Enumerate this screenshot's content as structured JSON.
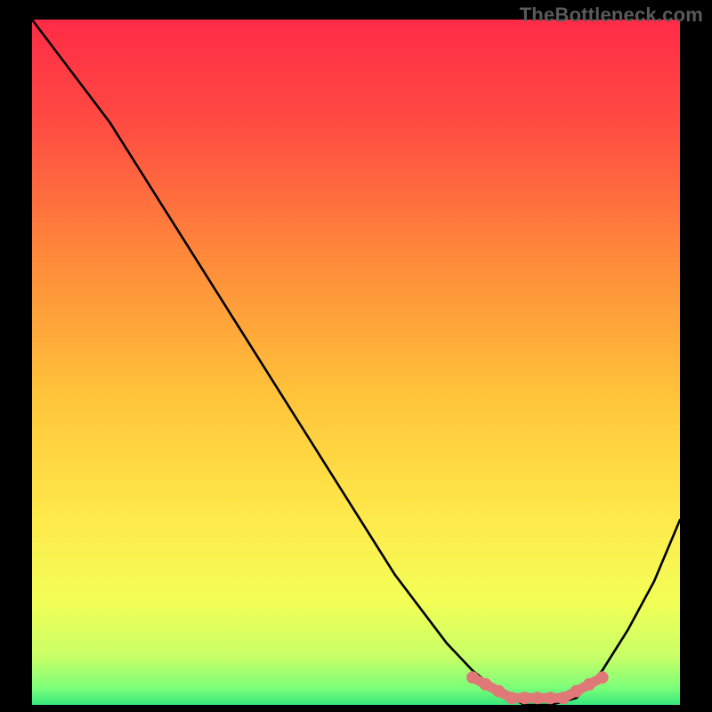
{
  "watermark": "TheBottleneck.com",
  "chart_data": {
    "type": "line",
    "title": "",
    "xlabel": "",
    "ylabel": "",
    "xlim": [
      0,
      100
    ],
    "ylim": [
      0,
      100
    ],
    "grid": false,
    "legend": false,
    "series": [
      {
        "name": "curve",
        "color": "#000000",
        "x": [
          0,
          4,
          8,
          12,
          16,
          20,
          24,
          28,
          32,
          36,
          40,
          44,
          48,
          52,
          56,
          60,
          64,
          68,
          72,
          76,
          80,
          84,
          88,
          92,
          96,
          100
        ],
        "y": [
          100,
          95,
          90,
          85,
          79,
          73,
          67,
          61,
          55,
          49,
          43,
          37,
          31,
          25,
          19,
          14,
          9,
          5,
          2,
          0,
          0,
          1,
          5,
          11,
          18,
          27
        ]
      },
      {
        "name": "highlight-band",
        "color": "#E07878",
        "markers": true,
        "x": [
          68,
          70,
          72,
          74,
          76,
          78,
          80,
          82,
          84,
          86,
          88
        ],
        "y": [
          4,
          3,
          2,
          1,
          1,
          1,
          1,
          1,
          2,
          3,
          4
        ]
      }
    ],
    "gradient": {
      "stops": [
        {
          "offset": 0.0,
          "color": "#FF2B47"
        },
        {
          "offset": 0.15,
          "color": "#FF4B42"
        },
        {
          "offset": 0.35,
          "color": "#FF8A3A"
        },
        {
          "offset": 0.55,
          "color": "#FFC43A"
        },
        {
          "offset": 0.72,
          "color": "#FFE84A"
        },
        {
          "offset": 0.85,
          "color": "#F3FF57"
        },
        {
          "offset": 0.93,
          "color": "#C8FF66"
        },
        {
          "offset": 0.975,
          "color": "#7CFF7A"
        },
        {
          "offset": 1.0,
          "color": "#36E87C"
        }
      ]
    },
    "plot_frame": {
      "x_pad": 36,
      "y_top": 22,
      "y_bottom": 8
    }
  }
}
